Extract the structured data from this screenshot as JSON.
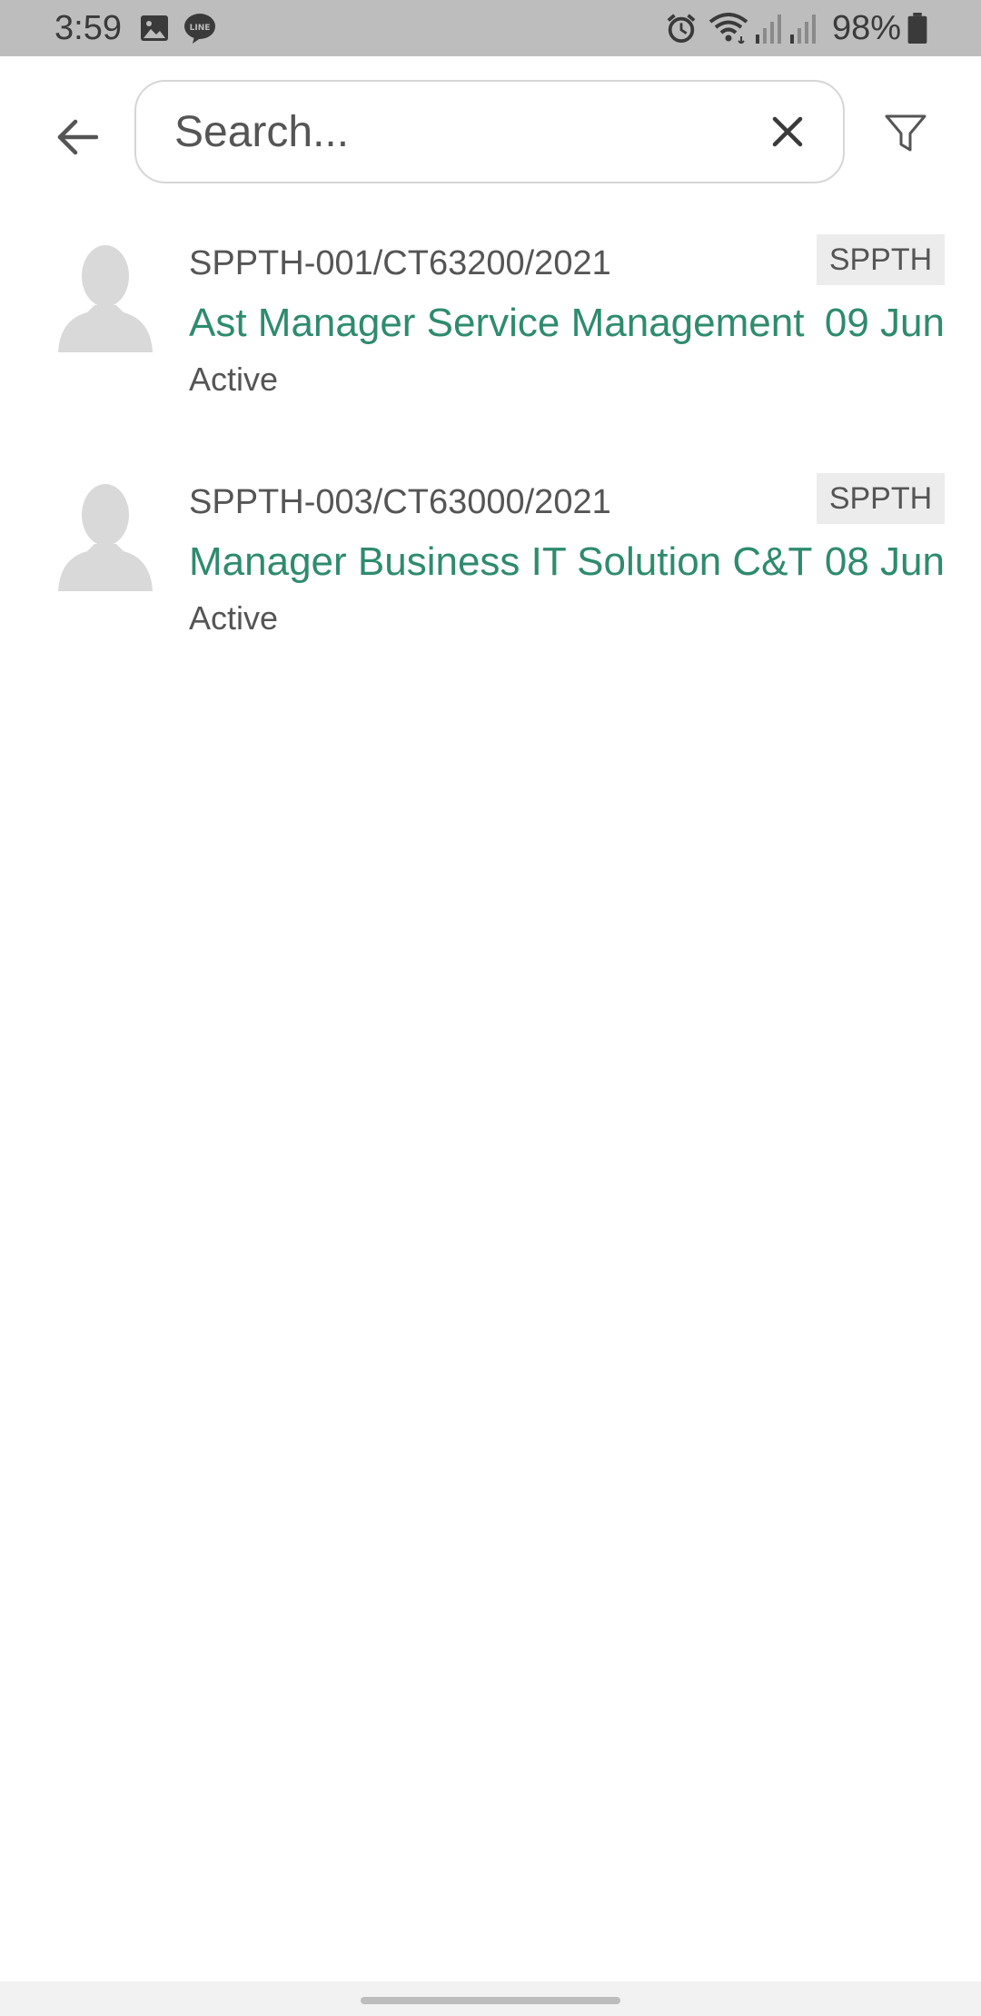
{
  "status_bar": {
    "time": "3:59",
    "battery": "98%",
    "icons": [
      "image-icon",
      "line-chat-icon",
      "alarm-icon",
      "wifi-icon",
      "signal-icon",
      "signal-icon",
      "battery-icon"
    ]
  },
  "search": {
    "placeholder": "Search...",
    "value": ""
  },
  "colors": {
    "accent": "#2e8b6e",
    "status_bar": "#bdbdbd",
    "badge_bg": "#ececec",
    "avatar": "#d9d9d9"
  },
  "items": [
    {
      "id": "SPPTH-001/CT63200/2021",
      "badge": "SPPTH",
      "title": "Ast Manager Service Management",
      "date": "09 Jun",
      "status": "Active"
    },
    {
      "id": "SPPTH-003/CT63000/2021",
      "badge": "SPPTH",
      "title": "Manager Business IT Solution C&T",
      "date": "08 Jun",
      "status": "Active"
    }
  ]
}
